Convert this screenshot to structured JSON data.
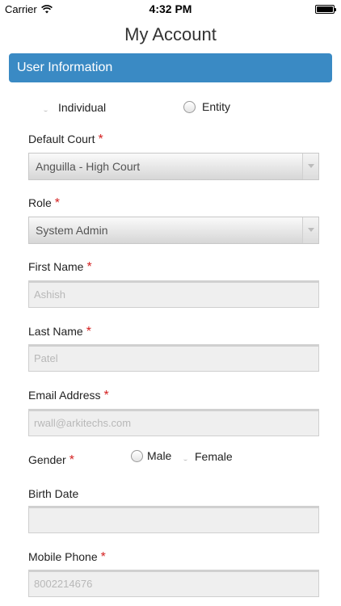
{
  "status_bar": {
    "carrier": "Carrier",
    "time": "4:32 PM"
  },
  "page_title": "My Account",
  "section": {
    "title": "User Information"
  },
  "entity_type": {
    "options": [
      "Individual",
      "Entity"
    ],
    "selected": "Individual"
  },
  "required_marker": "*",
  "fields": {
    "default_court": {
      "label": "Default Court",
      "value": "Anguilla - High Court"
    },
    "role": {
      "label": "Role",
      "value": "System Admin"
    },
    "first_name": {
      "label": "First Name",
      "value": "Ashish"
    },
    "last_name": {
      "label": "Last Name",
      "value": "Patel"
    },
    "email": {
      "label": "Email Address",
      "value": "rwall@arkitechs.com"
    },
    "gender": {
      "label": "Gender",
      "options": [
        "Male",
        "Female"
      ],
      "selected": "Female"
    },
    "birth_date": {
      "label": "Birth Date",
      "value": ""
    },
    "mobile_phone": {
      "label": "Mobile Phone",
      "value": "8002214676"
    }
  }
}
